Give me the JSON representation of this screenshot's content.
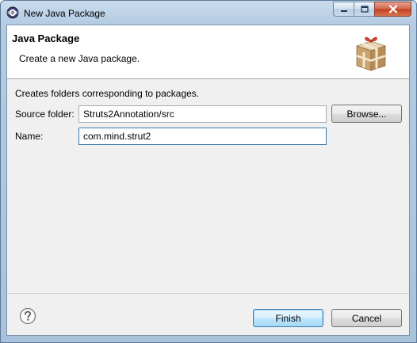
{
  "window": {
    "title": "New Java Package"
  },
  "banner": {
    "title": "Java Package",
    "description": "Create a new Java package.",
    "icon": "package-icon"
  },
  "form": {
    "description": "Creates folders corresponding to packages.",
    "source_folder": {
      "label": "Source folder:",
      "value": "Struts2Annotation/src"
    },
    "name": {
      "label": "Name:",
      "value": "com.mind.strut2"
    },
    "browse_label": "Browse..."
  },
  "footer": {
    "help_icon": "help-icon",
    "finish_label": "Finish",
    "cancel_label": "Cancel"
  },
  "colors": {
    "titlebar": "#b4cbe2",
    "dialog_bg": "#f0f0f0",
    "default_button_border": "#3c7fb1",
    "close_button": "#c23f22"
  }
}
